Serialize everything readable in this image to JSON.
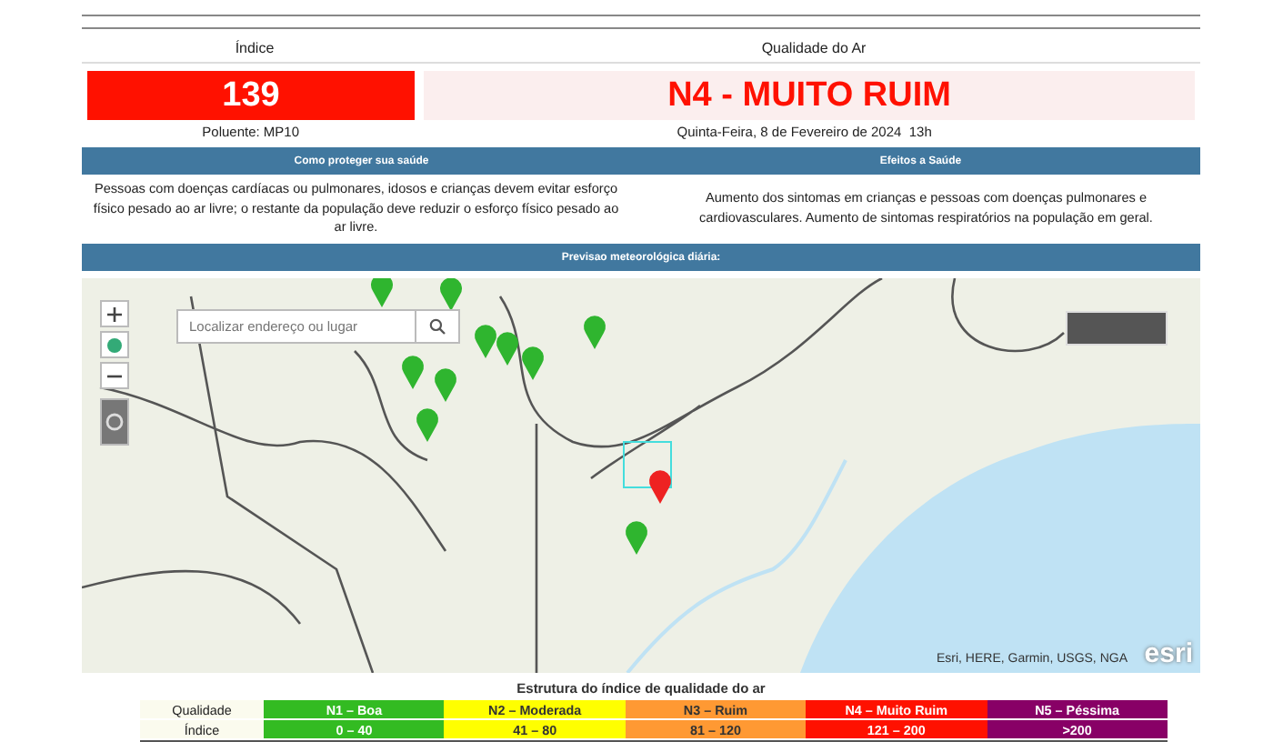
{
  "header": {
    "index_label": "Índice",
    "quality_label": "Qualidade do Ar"
  },
  "current": {
    "index": "139",
    "pollutant": "Poluente: MP10",
    "level": "N4 - MUITO RUIM",
    "color": "#ff1100",
    "datetime": "Quinta-Feira, 8 de Fevereiro de 2024  13h"
  },
  "health": {
    "protect_title": "Como proteger sua saúde",
    "effects_title": "Efeitos a Saúde",
    "protect_text": "Pessoas com doenças cardíacas ou pulmonares, idosos e crianças devem evitar esforço físico pesado ao ar livre; o restante da população deve reduzir o esforço físico pesado ao ar livre.",
    "effects_text": "Aumento dos sintomas em crianças e pessoas com doenças pulmonares e cardiovasculares. Aumento de sintomas respiratórios na população em geral."
  },
  "forecast": {
    "title": "Previsao meteorológica diária:"
  },
  "map": {
    "search_placeholder": "Localizar endereço ou lugar",
    "attribution": "Esri, HERE, Garmin, USGS, NGA",
    "logo": "esri",
    "markers": [
      {
        "color": "#2fb52f"
      },
      {
        "color": "#2fb52f"
      },
      {
        "color": "#2fb52f"
      },
      {
        "color": "#2fb52f"
      },
      {
        "color": "#2fb52f"
      },
      {
        "color": "#2fb52f"
      },
      {
        "color": "#2fb52f"
      },
      {
        "color": "#2fb52f"
      },
      {
        "color": "#2fb52f"
      },
      {
        "color": "#2fb52f"
      },
      {
        "color": "#ee2222"
      }
    ]
  },
  "scale": {
    "title": "Estrutura do índice de qualidade do ar",
    "row_labels": [
      "Qualidade",
      "Índice"
    ],
    "levels": [
      {
        "name": "N1 – Boa",
        "range": "0 – 40",
        "color": "#33bb22"
      },
      {
        "name": "N2 – Moderada",
        "range": "41 – 80",
        "color": "#ffff00"
      },
      {
        "name": "N3 – Ruim",
        "range": "81 – 120",
        "color": "#ff9933"
      },
      {
        "name": "N4 – Muito Ruim",
        "range": "121 – 200",
        "color": "#ff1100"
      },
      {
        "name": "N5 – Péssima",
        "range": ">200",
        "color": "#880066"
      }
    ]
  }
}
